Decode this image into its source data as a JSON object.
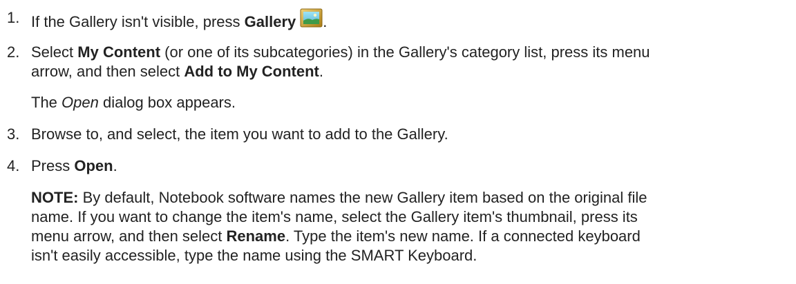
{
  "steps": [
    {
      "number": "1.",
      "text_before": "If the Gallery isn't visible, press ",
      "bold": "Gallery",
      "icon": "gallery-icon",
      "text_after": "."
    },
    {
      "number": "2.",
      "line1_before": "Select ",
      "line1_bold": "My Content",
      "line1_after": " (or one of its subcategories) in the Gallery's category list, press its menu",
      "line2_before": "arrow, and then select ",
      "line2_bold": "Add to My Content",
      "line2_after": ".",
      "result_before": "The ",
      "result_italic": "Open",
      "result_after": " dialog box appears."
    },
    {
      "number": "3.",
      "text": "Browse to, and select, the item you want to add to the Gallery."
    },
    {
      "number": "4.",
      "text_before": "Press ",
      "bold": "Open",
      "text_after": "."
    }
  ],
  "note": {
    "label": "NOTE:",
    "line1": " By default, Notebook software names the new Gallery item based on the original file",
    "line2": "name. If you want to change the item's name, select the Gallery item's thumbnail, press its",
    "line3_before": "menu arrow, and then select ",
    "line3_bold": "Rename",
    "line3_after": ". Type the item's new name. If a connected keyboard",
    "line4": "isn't easily accessible, type the name using the SMART Keyboard."
  },
  "colors": {
    "text": "#222222",
    "icon_frame": "#c9a227",
    "icon_sky": "#7fd0e8",
    "icon_hill": "#3f9b4a"
  }
}
